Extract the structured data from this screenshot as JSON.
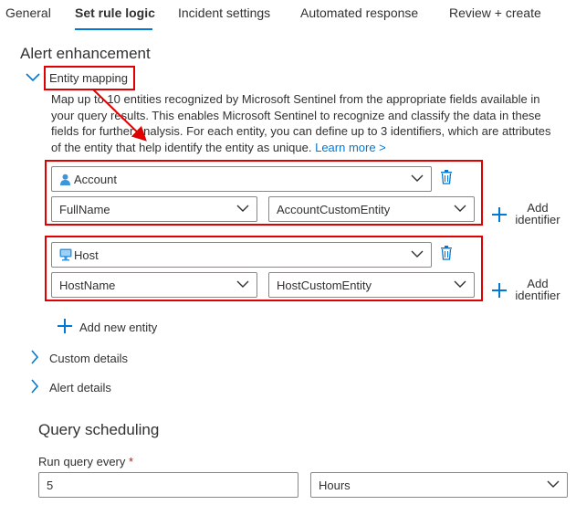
{
  "tabs": [
    {
      "label": "General"
    },
    {
      "label": "Set rule logic"
    },
    {
      "label": "Incident settings"
    },
    {
      "label": "Automated response"
    },
    {
      "label": "Review + create"
    }
  ],
  "alert_enhancement": {
    "title": "Alert enhancement",
    "entity_mapping": {
      "label": "Entity mapping",
      "description": "Map up to 10 entities recognized by Microsoft Sentinel from the appropriate fields available in your query results. This enables Microsoft Sentinel to recognize and classify the data in these fields for further analysis. For each entity, you can define up to 3 identifiers, which are attributes of the entity that help identify the entity as unique.",
      "learn_more": "Learn more >",
      "entities": [
        {
          "type": "Account",
          "identifier": "FullName",
          "column": "AccountCustomEntity",
          "add_identifier": "Add identifier"
        },
        {
          "type": "Host",
          "identifier": "HostName",
          "column": "HostCustomEntity",
          "add_identifier": "Add identifier"
        }
      ],
      "add_new_entity": "Add new entity"
    },
    "custom_details": "Custom details",
    "alert_details": "Alert details"
  },
  "query_scheduling": {
    "title": "Query scheduling",
    "run_query_label": "Run query every",
    "required_mark": "*",
    "run_query_value": "5",
    "run_query_unit": "Hours"
  },
  "colors": {
    "accent": "#0078d4",
    "highlight": "#e00000"
  }
}
